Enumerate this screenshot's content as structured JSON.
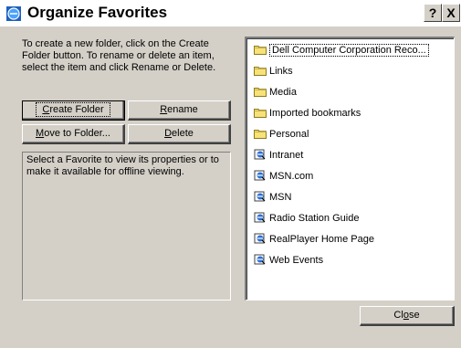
{
  "window": {
    "title": "Organize Favorites",
    "help_label": "?",
    "close_label": "X"
  },
  "instructions": "To create a new folder, click on the Create Folder button. To rename or delete an item, select the item and click Rename or Delete.",
  "buttons": {
    "create_folder_prefix": "",
    "create_folder_ul": "C",
    "create_folder_rest": "reate Folder",
    "rename_ul": "R",
    "rename_rest": "ename",
    "move_ul": "M",
    "move_rest": "ove to Folder...",
    "delete_ul": "D",
    "delete_rest": "elete",
    "close_pre": "Cl",
    "close_ul": "o",
    "close_rest": "se"
  },
  "info_text": "Select a Favorite to view its properties or to make it available for offline viewing.",
  "favorites": [
    {
      "label": "Dell Computer Corporation Reco...",
      "icon": "folder-icon",
      "selected": true
    },
    {
      "label": "Links",
      "icon": "folder-icon"
    },
    {
      "label": "Media",
      "icon": "folder-icon"
    },
    {
      "label": "Imported bookmarks",
      "icon": "folder-icon"
    },
    {
      "label": "Personal",
      "icon": "folder-icon"
    },
    {
      "label": "Intranet",
      "icon": "ie-link-icon"
    },
    {
      "label": "MSN.com",
      "icon": "ie-link-icon"
    },
    {
      "label": "MSN",
      "icon": "ie-link-icon"
    },
    {
      "label": "Radio Station Guide",
      "icon": "ie-link-icon"
    },
    {
      "label": "RealPlayer Home Page",
      "icon": "ie-link-icon"
    },
    {
      "label": "Web Events",
      "icon": "ie-link-icon"
    }
  ]
}
